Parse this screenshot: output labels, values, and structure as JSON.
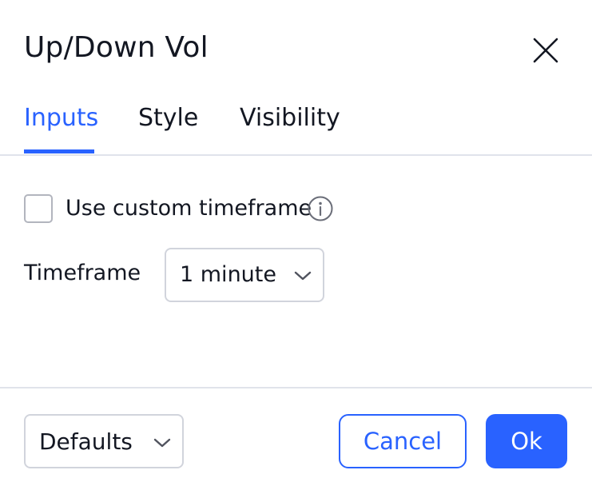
{
  "dialog": {
    "title": "Up/Down Vol",
    "close_icon": "close-icon"
  },
  "tabs": [
    {
      "label": "Inputs",
      "active": true
    },
    {
      "label": "Style",
      "active": false
    },
    {
      "label": "Visibility",
      "active": false
    }
  ],
  "inputs": {
    "custom_timeframe": {
      "label": "Use custom timeframe",
      "checked": false,
      "info_icon": "info-icon"
    },
    "timeframe": {
      "label": "Timeframe",
      "value": "1 minute"
    }
  },
  "footer": {
    "defaults_label": "Defaults",
    "cancel_label": "Cancel",
    "ok_label": "Ok"
  },
  "colors": {
    "accent": "#2962ff",
    "text": "#131722",
    "border": "#d1d4dc",
    "divider": "#e0e3eb"
  }
}
